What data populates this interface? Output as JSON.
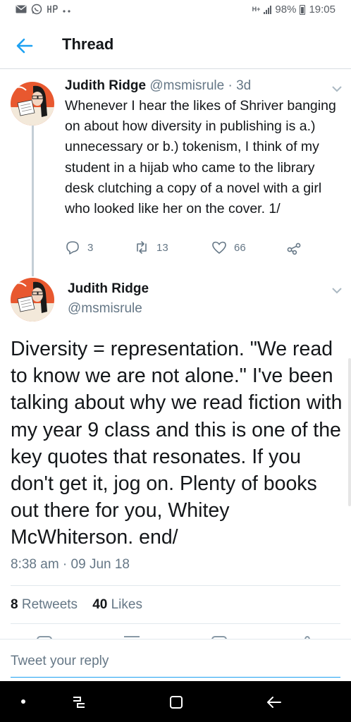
{
  "status_bar": {
    "left_icons": [
      "mail-icon",
      "whatsapp-icon",
      "data-icon",
      "more-icon"
    ],
    "network": "H+",
    "battery": "98%",
    "time": "19:05"
  },
  "header": {
    "title": "Thread"
  },
  "tweet1": {
    "name": "Judith Ridge",
    "handle": "@msmisrule · 3d",
    "text": "Whenever I hear the likes of Shriver banging on about how diversity in publishing is a.) unnecessary or b.) tokenism, I think of my student in a hijab who came to the library desk clutching a copy of a novel with a girl who looked like her on the cover. 1/",
    "replies": "3",
    "retweets": "13",
    "likes": "66"
  },
  "tweet2": {
    "name": "Judith Ridge",
    "handle": "@msmisrule",
    "text": "Diversity = representation. \"We read to know we are not alone.\" I've been talking about why we read fiction with my year 9 class and this is one of the key quotes that resonates. If you don't get it, jog on. Plenty of books out there for you, Whitey McWhiterson. end/",
    "timestamp": "8:38 am · 09 Jun 18",
    "retweet_count": "8",
    "retweet_label": "Retweets",
    "like_count": "40",
    "like_label": "Likes"
  },
  "reply": {
    "placeholder": "Tweet your reply"
  },
  "colors": {
    "accent": "#1da1f2",
    "text": "#14171a",
    "secondary": "#657786",
    "divider": "#e1e8ed"
  }
}
